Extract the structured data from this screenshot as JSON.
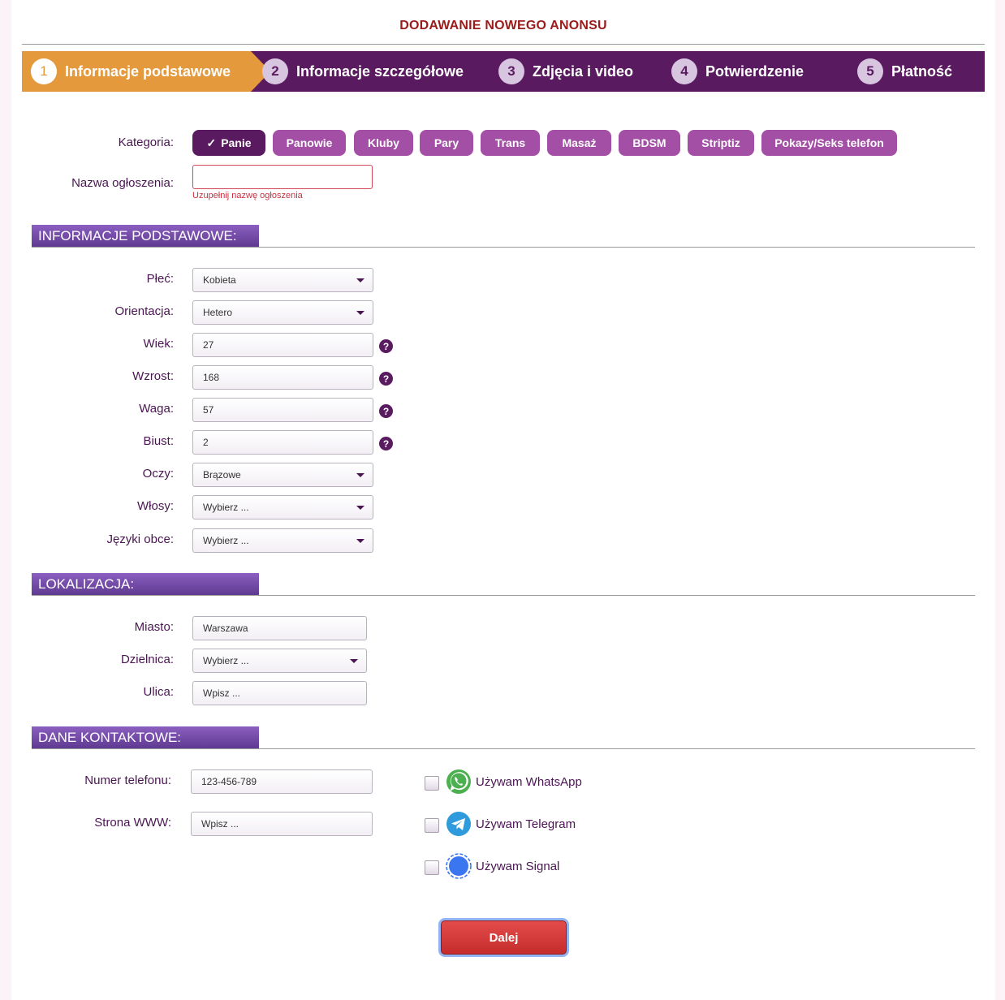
{
  "page_title": "DODAWANIE NOWEGO ANONSU",
  "steps": [
    {
      "num": "1",
      "label": "Informacje podstawowe",
      "active": true
    },
    {
      "num": "2",
      "label": "Informacje szczegółowe"
    },
    {
      "num": "3",
      "label": "Zdjęcia i video"
    },
    {
      "num": "4",
      "label": "Potwierdzenie"
    },
    {
      "num": "5",
      "label": "Płatność"
    }
  ],
  "category": {
    "label": "Kategoria:",
    "selected_mark": "✓",
    "options": [
      "Panie",
      "Panowie",
      "Kluby",
      "Pary",
      "Trans",
      "Masaż",
      "BDSM",
      "Striptiz",
      "Pokazy/Seks telefon"
    ]
  },
  "ad_name": {
    "label": "Nazwa ogłoszenia:",
    "value": "",
    "error": "Uzupełnij nazwę ogłoszenia"
  },
  "basic_section": {
    "title": "INFORMACJE PODSTAWOWE:",
    "gender": {
      "label": "Płeć:",
      "value": "Kobieta"
    },
    "orientation": {
      "label": "Orientacja:",
      "value": "Hetero"
    },
    "age": {
      "label": "Wiek:",
      "value": "27"
    },
    "height": {
      "label": "Wzrost:",
      "value": "168"
    },
    "weight": {
      "label": "Waga:",
      "value": "57"
    },
    "bust": {
      "label": "Biust:",
      "value": "2"
    },
    "eyes": {
      "label": "Oczy:",
      "value": "Brązowe"
    },
    "hair": {
      "label": "Włosy:",
      "value": "Wybierz ..."
    },
    "languages": {
      "label": "Języki obce:",
      "value": "Wybierz ..."
    },
    "help_glyph": "?"
  },
  "location_section": {
    "title": "LOKALIZACJA:",
    "city": {
      "label": "Miasto:",
      "value": "Warszawa"
    },
    "district": {
      "label": "Dzielnica:",
      "value": "Wybierz ..."
    },
    "street": {
      "label": "Ulica:",
      "placeholder": "Wpisz ..."
    }
  },
  "contact_section": {
    "title": "DANE KONTAKTOWE:",
    "phone": {
      "label": "Numer telefonu:",
      "value": "123-456-789"
    },
    "website": {
      "label": "Strona WWW:",
      "placeholder": "Wpisz ..."
    },
    "messengers": [
      {
        "label": "Używam WhatsApp",
        "icon": "whatsapp-icon",
        "color": "#4caf50"
      },
      {
        "label": "Używam Telegram",
        "icon": "telegram-icon",
        "color": "#2f9bdc"
      },
      {
        "label": "Używam Signal",
        "icon": "signal-icon",
        "color": "#3a76f0"
      }
    ]
  },
  "next_button": "Dalej",
  "colors": {
    "accent_orange": "#e49a3c",
    "dark_purple": "#5a1a60",
    "chip_purple": "#a34fa6",
    "title_red": "#9b1b1b",
    "button_red": "#d63a3a"
  }
}
